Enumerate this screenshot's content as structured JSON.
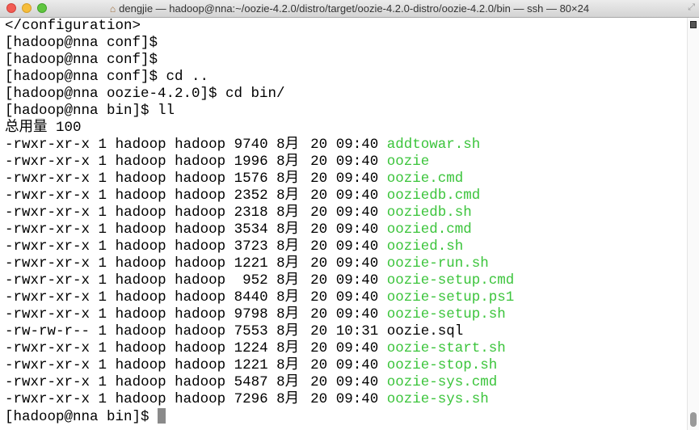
{
  "window": {
    "title": "dengjie — hadoop@nna:~/oozie-4.2.0/distro/target/oozie-4.2.0-distro/oozie-4.2.0/bin — ssh — 80×24"
  },
  "terminal": {
    "head_lines": [
      "</configuration>",
      "[hadoop@nna conf]$",
      "[hadoop@nna conf]$",
      "[hadoop@nna conf]$ cd ..",
      "[hadoop@nna oozie-4.2.0]$ cd bin/",
      "[hadoop@nna bin]$ ll",
      "总用量 100"
    ],
    "files": [
      {
        "perms": "-rwxr-xr-x",
        "links": "1",
        "owner": "hadoop",
        "group": "hadoop",
        "size": "9740",
        "month": "8月",
        "day": "20",
        "time": "09:40",
        "name": "addtowar.sh",
        "exec": true
      },
      {
        "perms": "-rwxr-xr-x",
        "links": "1",
        "owner": "hadoop",
        "group": "hadoop",
        "size": "1996",
        "month": "8月",
        "day": "20",
        "time": "09:40",
        "name": "oozie",
        "exec": true
      },
      {
        "perms": "-rwxr-xr-x",
        "links": "1",
        "owner": "hadoop",
        "group": "hadoop",
        "size": "1576",
        "month": "8月",
        "day": "20",
        "time": "09:40",
        "name": "oozie.cmd",
        "exec": true
      },
      {
        "perms": "-rwxr-xr-x",
        "links": "1",
        "owner": "hadoop",
        "group": "hadoop",
        "size": "2352",
        "month": "8月",
        "day": "20",
        "time": "09:40",
        "name": "ooziedb.cmd",
        "exec": true
      },
      {
        "perms": "-rwxr-xr-x",
        "links": "1",
        "owner": "hadoop",
        "group": "hadoop",
        "size": "2318",
        "month": "8月",
        "day": "20",
        "time": "09:40",
        "name": "ooziedb.sh",
        "exec": true
      },
      {
        "perms": "-rwxr-xr-x",
        "links": "1",
        "owner": "hadoop",
        "group": "hadoop",
        "size": "3534",
        "month": "8月",
        "day": "20",
        "time": "09:40",
        "name": "oozied.cmd",
        "exec": true
      },
      {
        "perms": "-rwxr-xr-x",
        "links": "1",
        "owner": "hadoop",
        "group": "hadoop",
        "size": "3723",
        "month": "8月",
        "day": "20",
        "time": "09:40",
        "name": "oozied.sh",
        "exec": true
      },
      {
        "perms": "-rwxr-xr-x",
        "links": "1",
        "owner": "hadoop",
        "group": "hadoop",
        "size": "1221",
        "month": "8月",
        "day": "20",
        "time": "09:40",
        "name": "oozie-run.sh",
        "exec": true
      },
      {
        "perms": "-rwxr-xr-x",
        "links": "1",
        "owner": "hadoop",
        "group": "hadoop",
        "size": "952",
        "month": "8月",
        "day": "20",
        "time": "09:40",
        "name": "oozie-setup.cmd",
        "exec": true
      },
      {
        "perms": "-rwxr-xr-x",
        "links": "1",
        "owner": "hadoop",
        "group": "hadoop",
        "size": "8440",
        "month": "8月",
        "day": "20",
        "time": "09:40",
        "name": "oozie-setup.ps1",
        "exec": true
      },
      {
        "perms": "-rwxr-xr-x",
        "links": "1",
        "owner": "hadoop",
        "group": "hadoop",
        "size": "9798",
        "month": "8月",
        "day": "20",
        "time": "09:40",
        "name": "oozie-setup.sh",
        "exec": true
      },
      {
        "perms": "-rw-rw-r--",
        "links": "1",
        "owner": "hadoop",
        "group": "hadoop",
        "size": "7553",
        "month": "8月",
        "day": "20",
        "time": "10:31",
        "name": "oozie.sql",
        "exec": false
      },
      {
        "perms": "-rwxr-xr-x",
        "links": "1",
        "owner": "hadoop",
        "group": "hadoop",
        "size": "1224",
        "month": "8月",
        "day": "20",
        "time": "09:40",
        "name": "oozie-start.sh",
        "exec": true
      },
      {
        "perms": "-rwxr-xr-x",
        "links": "1",
        "owner": "hadoop",
        "group": "hadoop",
        "size": "1221",
        "month": "8月",
        "day": "20",
        "time": "09:40",
        "name": "oozie-stop.sh",
        "exec": true
      },
      {
        "perms": "-rwxr-xr-x",
        "links": "1",
        "owner": "hadoop",
        "group": "hadoop",
        "size": "5487",
        "month": "8月",
        "day": "20",
        "time": "09:40",
        "name": "oozie-sys.cmd",
        "exec": true
      },
      {
        "perms": "-rwxr-xr-x",
        "links": "1",
        "owner": "hadoop",
        "group": "hadoop",
        "size": "7296",
        "month": "8月",
        "day": "20",
        "time": "09:40",
        "name": "oozie-sys.sh",
        "exec": true
      }
    ],
    "prompt": "[hadoop@nna bin]$",
    "colors": {
      "executable": "#3bc43b",
      "text": "#000000"
    }
  }
}
